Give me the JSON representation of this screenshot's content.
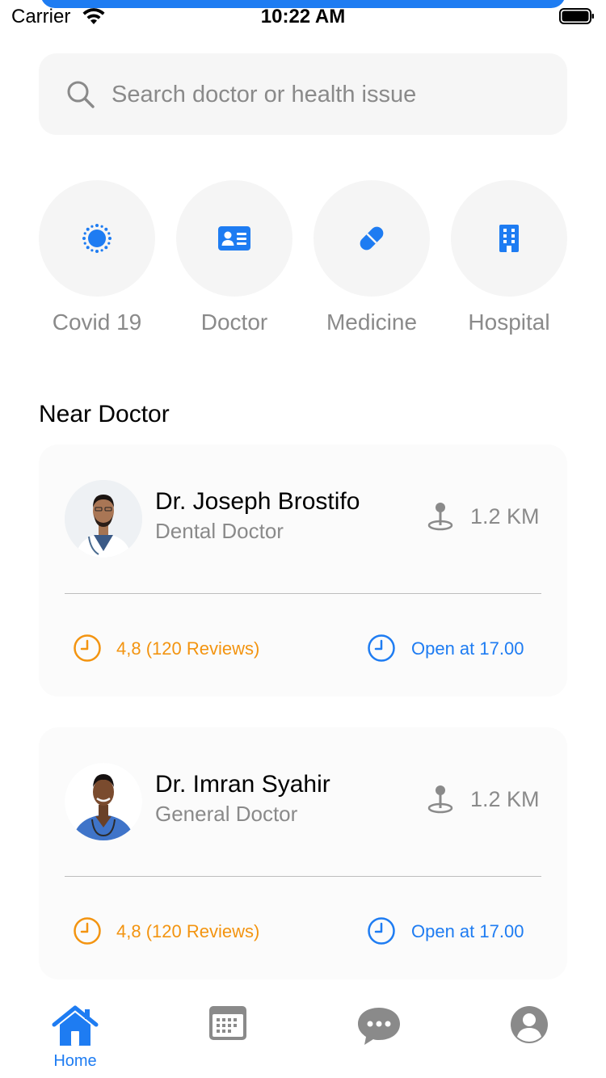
{
  "status_bar": {
    "carrier": "Carrier",
    "time": "10:22 AM"
  },
  "search": {
    "placeholder": "Search doctor or health issue",
    "icon": "search-icon"
  },
  "categories": [
    {
      "label": "Covid 19",
      "icon": "virus-icon"
    },
    {
      "label": "Doctor",
      "icon": "id-card-icon"
    },
    {
      "label": "Medicine",
      "icon": "pill-icon"
    },
    {
      "label": "Hospital",
      "icon": "hospital-building-icon"
    }
  ],
  "section_title": "Near Doctor",
  "doctors": [
    {
      "name": "Dr. Joseph Brostifo",
      "specialty": "Dental Doctor",
      "distance": "1.2 KM",
      "rating": "4,8 (120 Reviews)",
      "open": "Open at 17.00"
    },
    {
      "name": "Dr. Imran Syahir",
      "specialty": "General Doctor",
      "distance": "1.2 KM",
      "rating": "4,8 (120 Reviews)",
      "open": "Open at 17.00"
    }
  ],
  "tab_bar": {
    "active": "Home",
    "home_label": "Home",
    "tabs": [
      "home-icon",
      "calendar-icon",
      "chat-icon",
      "profile-icon"
    ]
  },
  "colors": {
    "accent": "#1e7cf2",
    "rating": "#f39410",
    "muted": "#8a8a8a",
    "card": "#fbfbfb"
  }
}
